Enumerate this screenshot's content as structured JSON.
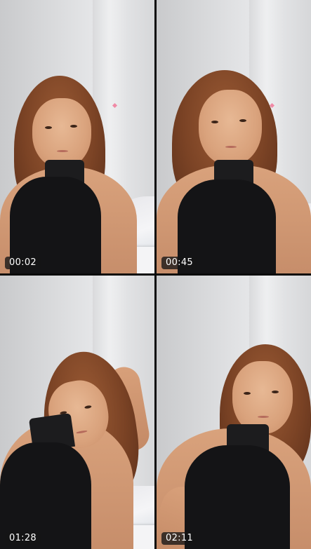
{
  "grid": {
    "tiles": [
      {
        "timestamp": "00:02"
      },
      {
        "timestamp": "00:45"
      },
      {
        "timestamp": "01:28"
      },
      {
        "timestamp": "02:11"
      }
    ]
  },
  "colors": {
    "background": "#0b0b0b",
    "wall": "#dedfe1",
    "top": "#141416",
    "hair": "#7b4325",
    "sparkle": "#f08aa6"
  },
  "icons": [
    "sparkle-icon"
  ]
}
